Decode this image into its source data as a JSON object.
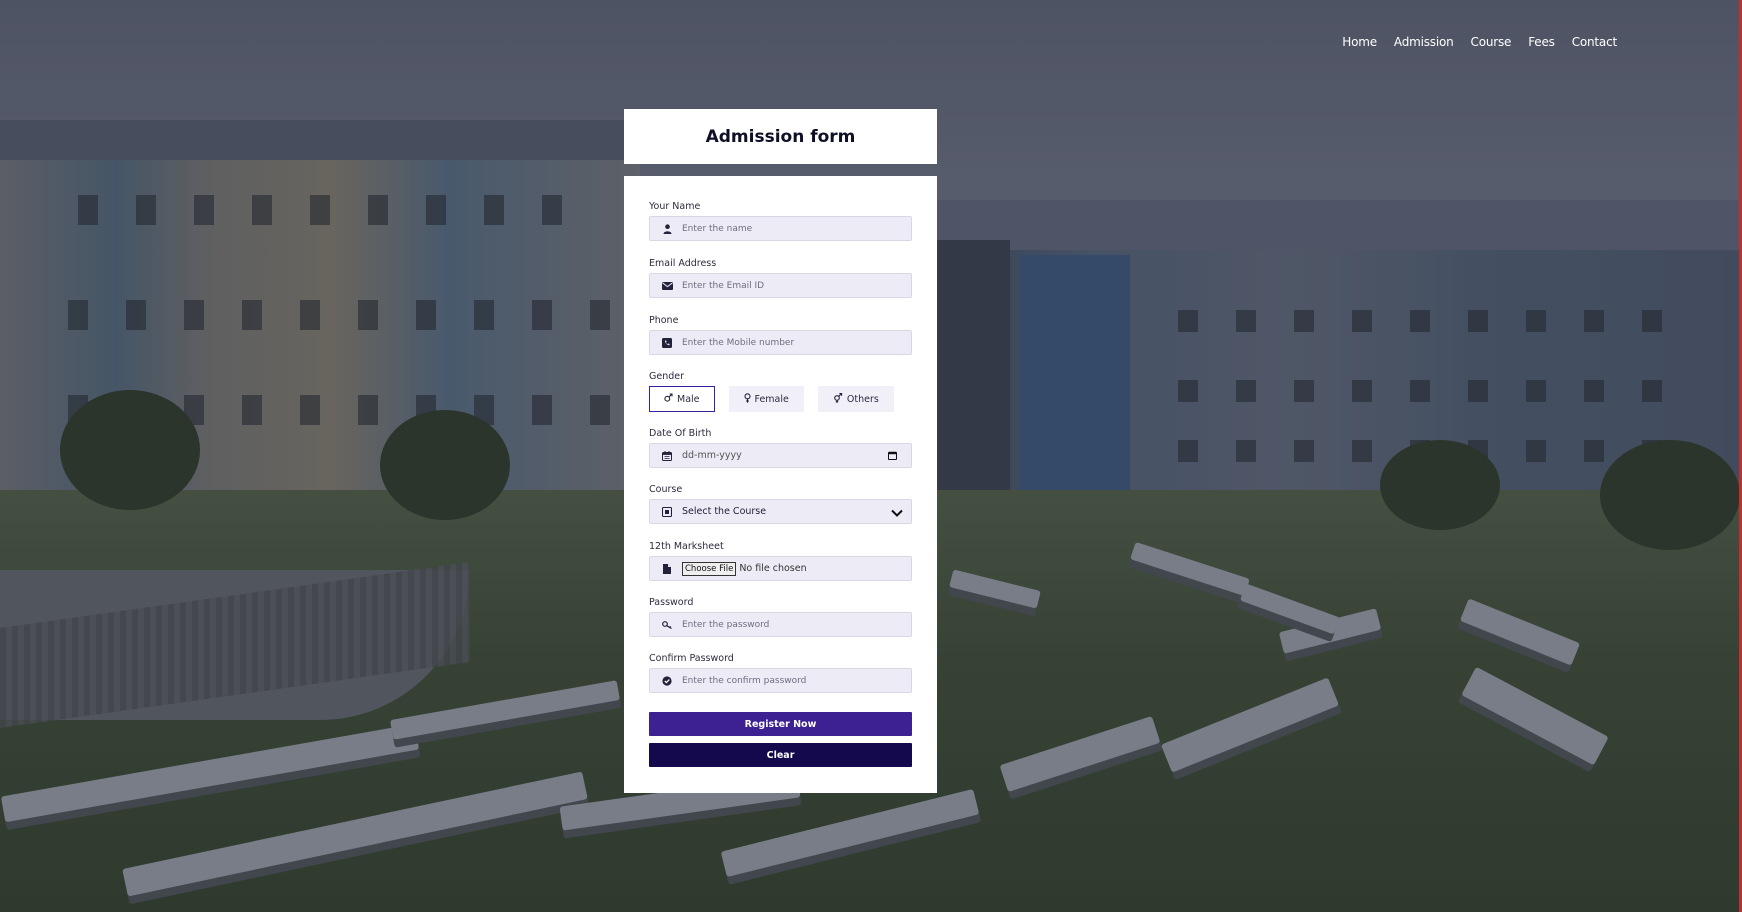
{
  "nav": {
    "items": [
      {
        "label": "Home"
      },
      {
        "label": "Admission"
      },
      {
        "label": "Course"
      },
      {
        "label": "Fees"
      },
      {
        "label": "Contact"
      }
    ]
  },
  "form": {
    "title": "Admission form",
    "name": {
      "label": "Your Name",
      "placeholder": "Enter the name",
      "icon": "user-icon"
    },
    "email": {
      "label": "Email Address",
      "placeholder": "Enter the Email ID",
      "icon": "envelope-icon"
    },
    "phone": {
      "label": "Phone",
      "placeholder": "Enter the Mobile number",
      "icon": "phone-icon"
    },
    "gender": {
      "label": "Gender",
      "options": [
        {
          "label": "Male",
          "icon": "male-icon",
          "selected": true
        },
        {
          "label": "Female",
          "icon": "female-icon",
          "selected": false
        },
        {
          "label": "Others",
          "icon": "transgender-icon",
          "selected": false
        }
      ]
    },
    "dob": {
      "label": "Date Of Birth",
      "value": "dd-mm-yyyy",
      "icon": "calendar-icon"
    },
    "course": {
      "label": "Course",
      "selected": "Select the Course",
      "icon": "course-icon"
    },
    "marksheet": {
      "label": "12th Marksheet",
      "button": "Choose File",
      "status": "No file chosen",
      "icon": "file-icon"
    },
    "password": {
      "label": "Password",
      "placeholder": "Enter the password",
      "icon": "key-icon"
    },
    "confirm_password": {
      "label": "Confirm Password",
      "placeholder": "Enter the confirm password",
      "icon": "check-circle-icon"
    },
    "register_label": "Register Now",
    "clear_label": "Clear"
  },
  "colors": {
    "primary": "#3d2192",
    "dark": "#14094d",
    "input_bg": "#ecebf6"
  }
}
